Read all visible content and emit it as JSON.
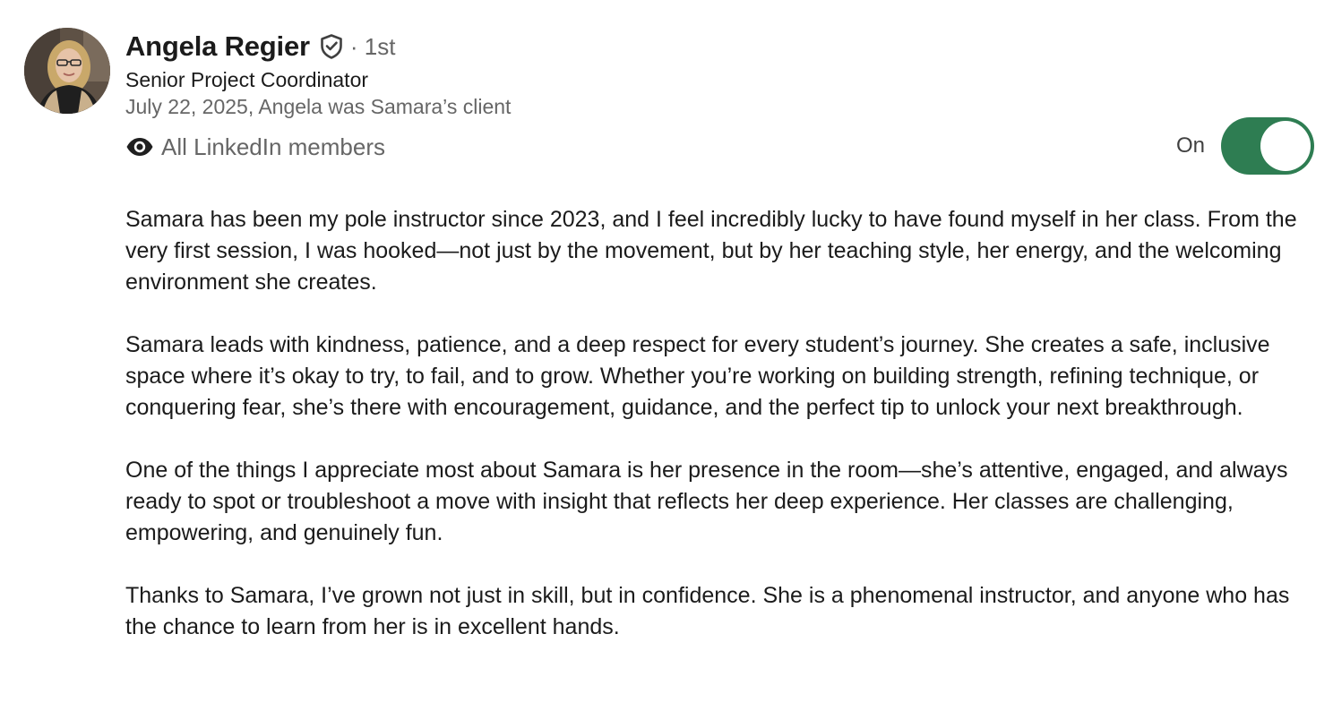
{
  "recommender": {
    "name": "Angela Regier",
    "verified_icon": "shield-check-icon",
    "degree": "· 1st",
    "headline": "Senior Project Coordinator",
    "relationship": "July 22, 2025, Angela was Samara’s client"
  },
  "visibility": {
    "icon": "eye-icon",
    "label": "All LinkedIn members"
  },
  "display_toggle": {
    "label": "On",
    "state": "on",
    "color": "#2e7d52"
  },
  "recommendation": {
    "paragraphs": [
      "Samara has been my pole instructor since 2023, and I feel incredibly lucky to have found myself in her class. From the very first session, I was hooked—not just by the movement, but by her teaching style, her energy, and the welcoming environment she creates.",
      "Samara leads with kindness, patience, and a deep respect for every student’s journey. She creates a safe, inclusive space where it’s okay to try, to fail, and to grow. Whether you’re working on building strength, refining technique, or conquering fear, she’s there with encouragement, guidance, and the perfect tip to unlock your next breakthrough.",
      "One of the things I appreciate most about Samara is her presence in the room—she’s attentive, engaged, and always ready to spot or troubleshoot a move with insight that reflects her deep experience. Her classes are challenging, empowering, and genuinely fun.",
      "Thanks to Samara, I’ve grown not just in skill, but in confidence. She is a phenomenal instructor, and anyone who has the chance to learn from her is in excellent hands."
    ]
  }
}
